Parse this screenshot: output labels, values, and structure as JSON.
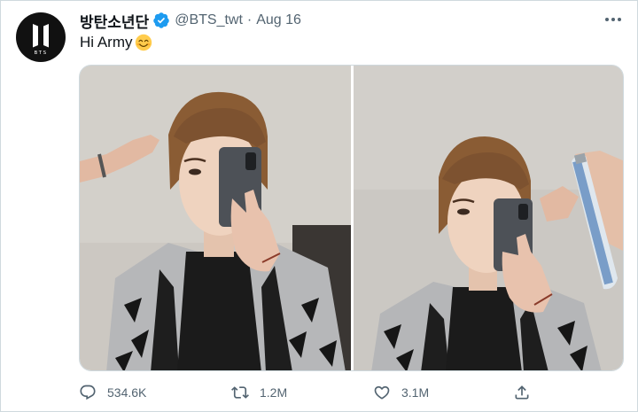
{
  "tweet": {
    "display_name": "방탄소년단",
    "handle": "@BTS_twt",
    "separator": "·",
    "date": "Aug 16",
    "text": "Hi Army",
    "avatar_logo_text": "BTS",
    "emoji": "smiling-face-emoji",
    "verified_icon": "verified-badge-icon",
    "more_icon": "more-options-icon"
  },
  "media": {
    "count": 2,
    "photos": [
      {
        "name": "photo-1",
        "description_icon": "mirror-selfie-photo"
      },
      {
        "name": "photo-2",
        "description_icon": "mirror-selfie-photo"
      }
    ]
  },
  "actions": {
    "reply": {
      "icon": "reply-icon",
      "count": "534.6K"
    },
    "retweet": {
      "icon": "retweet-icon",
      "count": "1.2M"
    },
    "like": {
      "icon": "heart-icon",
      "count": "3.1M"
    },
    "share": {
      "icon": "share-icon"
    }
  },
  "colors": {
    "text_primary": "#0f1419",
    "text_secondary": "#536471",
    "verified_blue": "#1d9bf0",
    "border": "#cfd9de",
    "avatar_bg": "#111111"
  }
}
